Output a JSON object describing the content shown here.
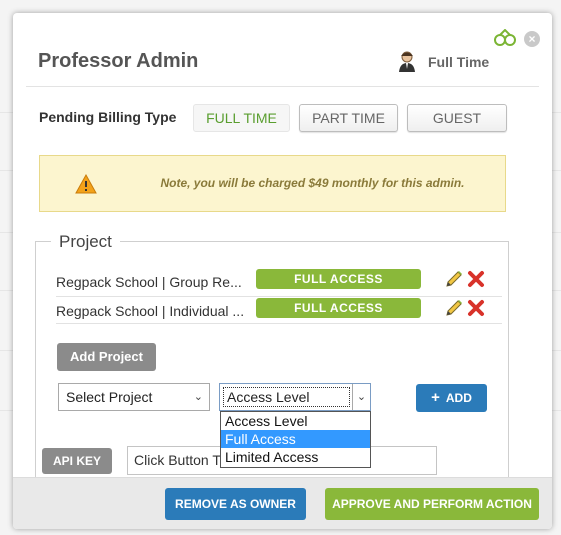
{
  "modal": {
    "title": "Professor Admin",
    "employment_type": "Full Time"
  },
  "billing": {
    "label": "Pending Billing Type",
    "options": [
      {
        "label": "FULL TIME",
        "active": true
      },
      {
        "label": "PART TIME",
        "active": false
      },
      {
        "label": "GUEST",
        "active": false
      }
    ]
  },
  "note": {
    "text": "Note, you will be charged $49 monthly for this admin."
  },
  "project_section": {
    "legend": "Project",
    "rows": [
      {
        "name": "Regpack School | Group Re...",
        "access": "FULL ACCESS"
      },
      {
        "name": "Regpack School | Individual ...",
        "access": "FULL ACCESS"
      }
    ],
    "add_project_label": "Add Project",
    "select_project": "Select Project",
    "access_level": "Access Level",
    "add_label": "ADD",
    "access_options": [
      "Access Level",
      "Full Access",
      "Limited Access"
    ],
    "selected_option_index": 1
  },
  "api": {
    "button_label": "API KEY",
    "input_value": "Click Button T"
  },
  "footer": {
    "remove_label": "REMOVE AS OWNER",
    "approve_label": "APPROVE AND PERFORM ACTION"
  },
  "colors": {
    "green": "#8ab83a",
    "blue": "#2b7bb9",
    "gray_button": "#8b8b8b",
    "note_bg": "#fcf5cf"
  },
  "icons": [
    "ninja-icon",
    "close-icon",
    "person-icon",
    "warning-icon",
    "pencil-icon",
    "delete-icon",
    "plus-icon",
    "chevron-down-icon"
  ]
}
